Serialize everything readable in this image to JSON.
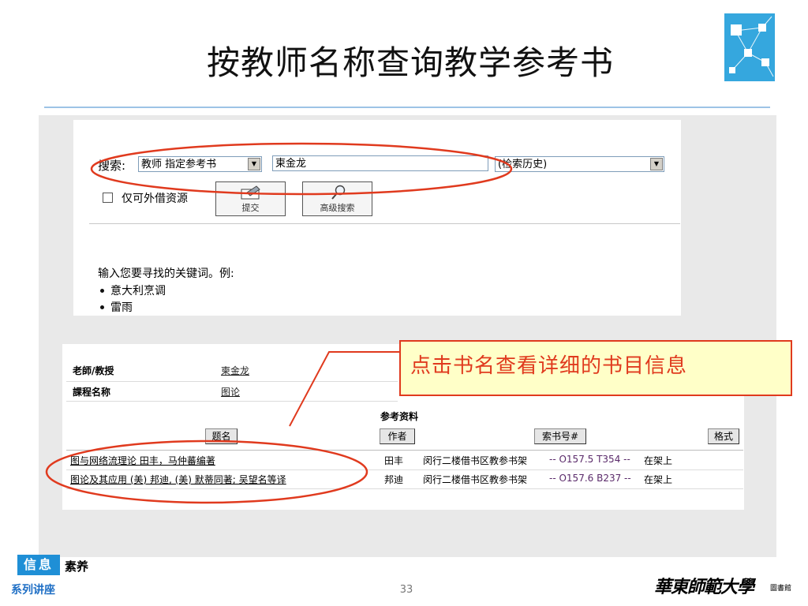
{
  "slide": {
    "title": "按教师名称查询教学参考书",
    "page_number": "33"
  },
  "search_panel": {
    "search_label": "搜索:",
    "field_select": "教师 指定参考书",
    "query_value": "柬金龙",
    "history_select": "(检索历史)",
    "checkbox_label": "仅可外借资源",
    "checkbox_checked": false,
    "submit_label": "提交",
    "advanced_label": "高级搜索",
    "hint": "输入您要寻找的关键词。例:",
    "examples": [
      "意大利烹调",
      "雷雨"
    ]
  },
  "results": {
    "teacher_label": "老師/教授",
    "teacher_value": "柬金龙",
    "course_label": "課程名称",
    "course_value": "图论",
    "refs_heading": "参考资料",
    "columns": {
      "title": "题名",
      "author": "作者",
      "call_number": "索书号#",
      "format": "格式"
    },
    "rows": [
      {
        "title": "图与网络流理论 田丰，马仲蕃编著",
        "author": "田丰",
        "location": "闵行二楼借书区教参书架",
        "call_number": "-- O157.5 T354 --",
        "status": "在架上"
      },
      {
        "title": "图论及其应用 (美) 邦迪, (美) 默蒂同著; 吴望名等译",
        "author": "邦迪",
        "location": "闵行二楼借书区教参书架",
        "call_number": "-- O157.6 B237 --",
        "status": "在架上"
      }
    ]
  },
  "callout": {
    "text": "点击书名查看详细的书目信息"
  },
  "footer": {
    "badge": "信息",
    "badge_suffix": "素养",
    "series": "系列讲座",
    "university": "華東師範大學",
    "library": "圖書館"
  },
  "colors": {
    "accent_blue": "#1f8fd6",
    "annotation_red": "#e03a1e",
    "callout_fill": "#ffffc8",
    "title_rule": "#9dc3e6",
    "logo_tile": "#35a7de"
  }
}
